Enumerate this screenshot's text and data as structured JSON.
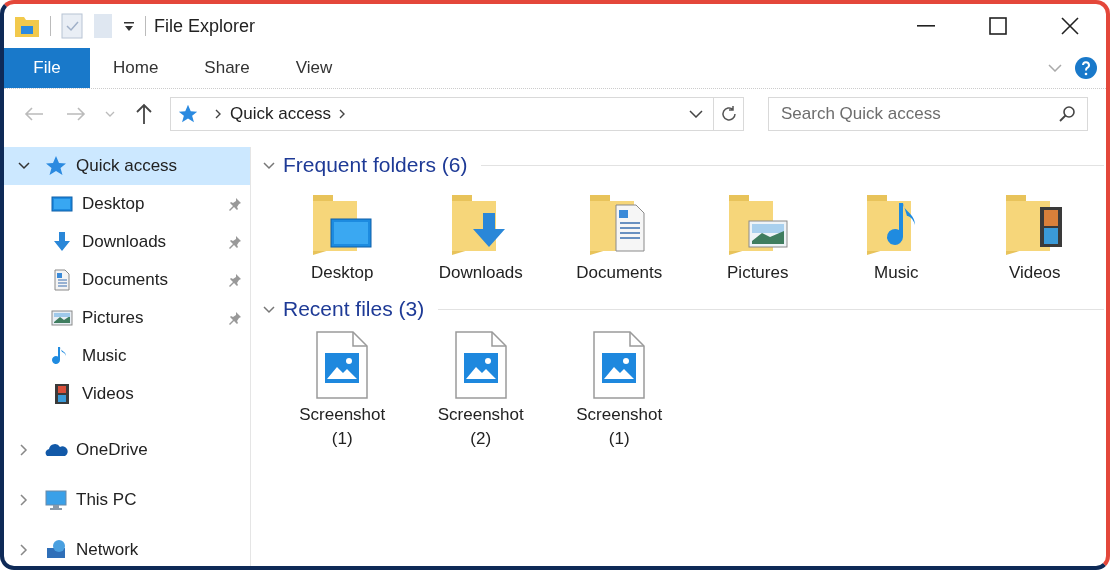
{
  "window": {
    "title": "File Explorer"
  },
  "ribbon": {
    "file_button": "File",
    "tabs": [
      {
        "label": "Home",
        "selected": false
      },
      {
        "label": "Share",
        "selected": false
      },
      {
        "label": "View",
        "selected": false
      }
    ]
  },
  "address_bar": {
    "location": "Quick access"
  },
  "search": {
    "placeholder": "Search Quick access"
  },
  "navigation": {
    "items": [
      {
        "label": "Quick access",
        "kind": "star",
        "expanded": true,
        "selected": true,
        "children": [
          {
            "label": "Desktop",
            "kind": "desktop",
            "pinned": true,
            "selected": false
          },
          {
            "label": "Downloads",
            "kind": "downloads",
            "pinned": true,
            "selected": false
          },
          {
            "label": "Documents",
            "kind": "documents",
            "pinned": true,
            "selected": false
          },
          {
            "label": "Pictures",
            "kind": "pictures",
            "pinned": true,
            "selected": false
          },
          {
            "label": "Music",
            "kind": "music",
            "pinned": false,
            "selected": false
          },
          {
            "label": "Videos",
            "kind": "videos",
            "pinned": false,
            "selected": false
          }
        ]
      },
      {
        "label": "OneDrive",
        "kind": "cloud",
        "expanded": false,
        "selected": false
      },
      {
        "label": "This PC",
        "kind": "computer",
        "expanded": false,
        "selected": false
      },
      {
        "label": "Network",
        "kind": "network",
        "expanded": false,
        "selected": false
      }
    ]
  },
  "content": {
    "sections": [
      {
        "title": "Frequent folders (6)",
        "kind": "folders",
        "expanded": true,
        "items": [
          {
            "label": "Desktop",
            "kind": "desktop"
          },
          {
            "label": "Downloads",
            "kind": "downloads"
          },
          {
            "label": "Documents",
            "kind": "documents"
          },
          {
            "label": "Pictures",
            "kind": "pictures"
          },
          {
            "label": "Music",
            "kind": "music"
          },
          {
            "label": "Videos",
            "kind": "videos"
          }
        ]
      },
      {
        "title": "Recent files (3)",
        "kind": "files",
        "expanded": true,
        "items": [
          {
            "label": "Screenshot (1)"
          },
          {
            "label": "Screenshot (2)"
          },
          {
            "label": "Screenshot (1)"
          }
        ]
      }
    ]
  }
}
